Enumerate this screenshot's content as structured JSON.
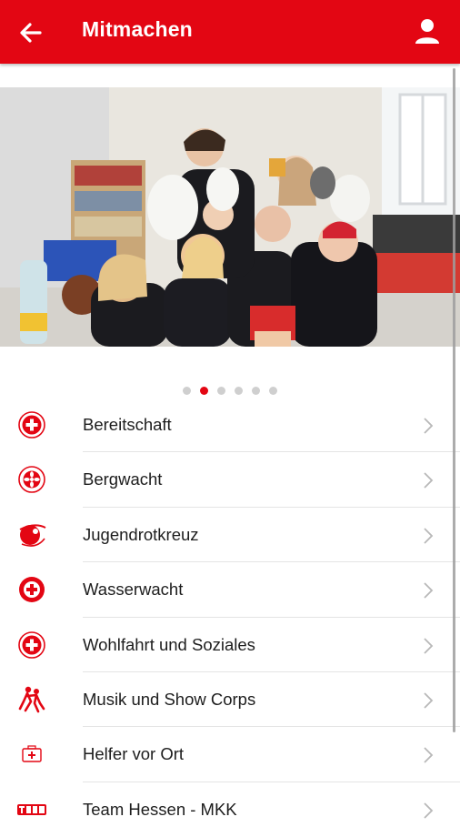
{
  "appbar": {
    "title": "Mitmachen",
    "back_icon": "arrow-left-icon",
    "profile_icon": "person-icon",
    "color": "#e30613"
  },
  "carousel": {
    "slide_count": 6,
    "active_index": 1
  },
  "menu": {
    "items": [
      {
        "label": "Bereitschaft",
        "icon": "red-cross-badge-icon"
      },
      {
        "label": "Bergwacht",
        "icon": "edelweiss-badge-icon"
      },
      {
        "label": "Jugendrotkreuz",
        "icon": "jugendrotkreuz-logo-icon"
      },
      {
        "label": "Wasserwacht",
        "icon": "wasserwacht-badge-icon"
      },
      {
        "label": "Wohlfahrt und Soziales",
        "icon": "red-cross-badge-icon"
      },
      {
        "label": "Musik und Show Corps",
        "icon": "dancers-icon"
      },
      {
        "label": "Helfer vor Ort",
        "icon": "first-aid-kit-icon"
      },
      {
        "label": "Team Hessen - MKK",
        "icon": "team-logo-icon"
      }
    ]
  }
}
